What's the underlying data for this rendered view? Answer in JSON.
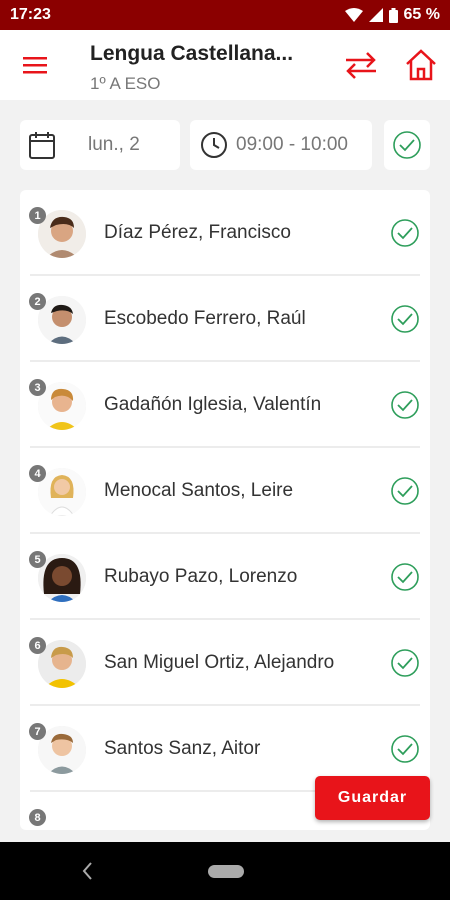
{
  "status": {
    "time": "17:23",
    "battery": "65 %"
  },
  "header": {
    "title": "Lengua Castellana...",
    "subtitle": "1º A ESO"
  },
  "filters": {
    "date": "lun., 2",
    "time": "09:00 - 10:00"
  },
  "students": [
    {
      "number": "1",
      "name": "Díaz Pérez, Francisco"
    },
    {
      "number": "2",
      "name": "Escobedo Ferrero, Raúl"
    },
    {
      "number": "3",
      "name": "Gadañón Iglesia, Valentín"
    },
    {
      "number": "4",
      "name": "Menocal Santos, Leire"
    },
    {
      "number": "5",
      "name": "Rubayo Pazo, Lorenzo"
    },
    {
      "number": "6",
      "name": "San Miguel Ortiz, Alejandro"
    },
    {
      "number": "7",
      "name": "Santos Sanz, Aitor"
    },
    {
      "number": "8",
      "name": ""
    }
  ],
  "actions": {
    "save_label": "Guardar"
  },
  "colors": {
    "accent": "#e8141a",
    "statusbar": "#8b0000",
    "check": "#2e9e5b"
  }
}
